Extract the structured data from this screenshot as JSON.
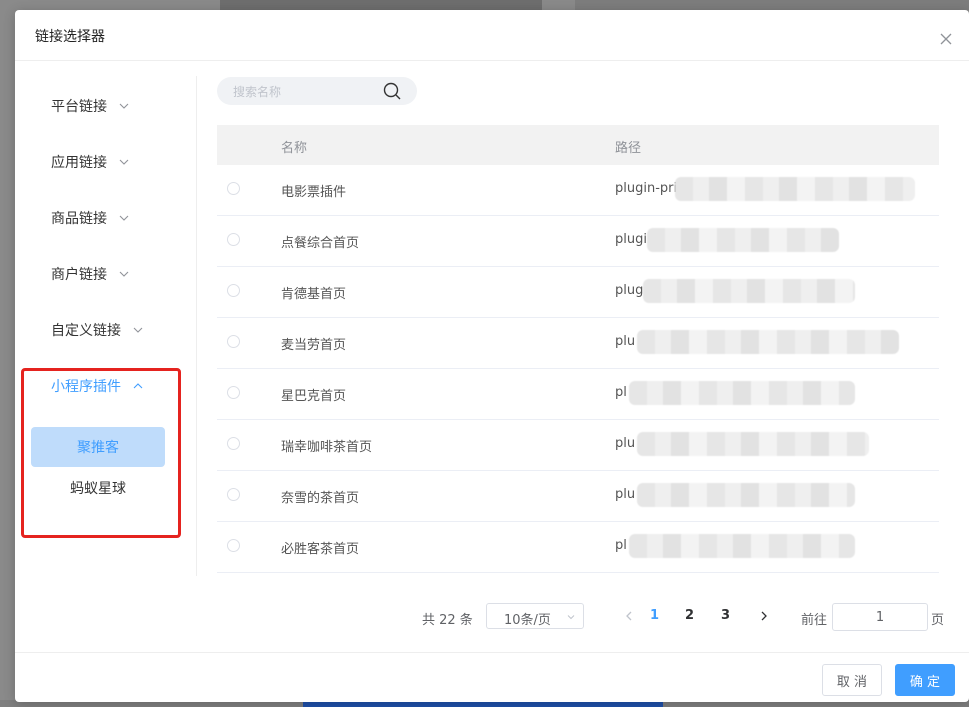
{
  "dialog": {
    "title": "链接选择器"
  },
  "sidebar": {
    "groups": [
      {
        "label": "平台链接",
        "expanded": false
      },
      {
        "label": "应用链接",
        "expanded": false
      },
      {
        "label": "商品链接",
        "expanded": false
      },
      {
        "label": "商户链接",
        "expanded": false
      },
      {
        "label": "自定义链接",
        "expanded": false
      },
      {
        "label": "小程序插件",
        "expanded": true
      }
    ],
    "sub_items": [
      {
        "label": "聚推客",
        "selected": true
      },
      {
        "label": "蚂蚁星球",
        "selected": false
      }
    ]
  },
  "search": {
    "placeholder": "搜索名称",
    "value": ""
  },
  "table": {
    "columns": [
      "名称",
      "路径"
    ],
    "rows": [
      {
        "name": "电影票插件",
        "path": "plugin-pri"
      },
      {
        "name": "点餐综合首页",
        "path": "plugi"
      },
      {
        "name": "肯德基首页",
        "path": "plug"
      },
      {
        "name": "麦当劳首页",
        "path": "plu"
      },
      {
        "name": "星巴克首页",
        "path": "pl"
      },
      {
        "name": "瑞幸咖啡茶首页",
        "path": "plu"
      },
      {
        "name": "奈雪的茶首页",
        "path": "plu"
      },
      {
        "name": "必胜客茶首页",
        "path": "pl"
      }
    ]
  },
  "pagination": {
    "total_text": "共 22 条",
    "page_size": "10条/页",
    "pages": [
      "1",
      "2",
      "3"
    ],
    "current_page": "1",
    "goto_label": "前往",
    "goto_value": "1",
    "page_word": "页"
  },
  "footer": {
    "cancel_label": "取 消",
    "confirm_label": "确 定"
  },
  "colors": {
    "accent": "#409eff",
    "highlight_border": "#e5231f",
    "selected_bg": "#bfdcfb"
  }
}
